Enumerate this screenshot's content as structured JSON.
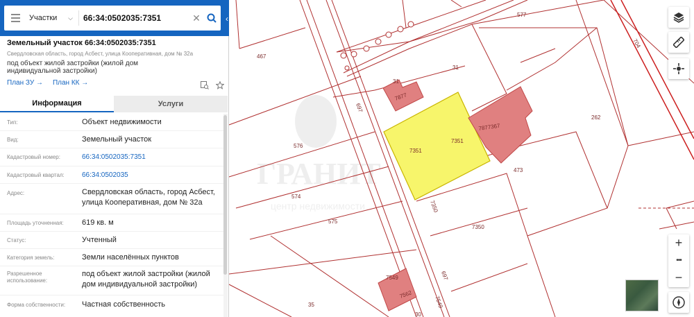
{
  "search": {
    "layer": "Участки",
    "query": "66:34:0502035:7351"
  },
  "object": {
    "title": "Земельный участок 66:34:0502035:7351",
    "address_short": "Свердловская область, город Асбест, улица Кооперативная, дом № 32а",
    "usage": "под объект жилой застройки (жилой дом индивидуальной застройки)",
    "links": [
      "План ЗУ →",
      "План КК →"
    ]
  },
  "tabs": [
    {
      "label": "Информация",
      "active": true
    },
    {
      "label": "Услуги",
      "active": false
    }
  ],
  "properties": [
    {
      "key": "Тип:",
      "value": "Объект недвижимости",
      "link": false
    },
    {
      "key": "Вид:",
      "value": "Земельный участок",
      "link": false
    },
    {
      "key": "Кадастровый номер:",
      "value": "66:34:0502035:7351",
      "link": true
    },
    {
      "key": "Кадастровый квартал:",
      "value": "66:34:0502035",
      "link": true
    },
    {
      "key": "Адрес:",
      "value": "Свердловская область, город Асбест, улица Кооперативная, дом № 32а",
      "link": false
    },
    {
      "key": "Площадь уточненная:",
      "value": "619 кв. м",
      "link": false
    },
    {
      "key": "Статус:",
      "value": "Учтенный",
      "link": false
    },
    {
      "key": "Категория земель:",
      "value": "Земли населённых пунктов",
      "link": false
    },
    {
      "key": "Разрешенное использование:",
      "value": "под объект жилой застройки (жилой дом индивидуальной застройки)",
      "link": false
    },
    {
      "key": "Форма собственности:",
      "value": "Частная собственность",
      "link": false
    }
  ],
  "map": {
    "watermark_lines": [
      "ГРАНИТ",
      "центр недвижимости"
    ],
    "labels": {
      "p467": "467",
      "p577": "577",
      "p31a": "31",
      "p31b": "31",
      "p7877": "7877",
      "p576": "576",
      "p7351a": "7351",
      "p7351b": "7351",
      "p7877_7367": "7877367",
      "p262": "262",
      "p473": "473",
      "p574": "574",
      "p575": "575",
      "p7350a": "7350",
      "p7350b": "7350",
      "p697a": "697",
      "p697b": "697",
      "p7549": "7549",
      "p7562": "7562",
      "p35": "35",
      "p7549b": "7549",
      "p30": "30",
      "p704": "704"
    },
    "colors": {
      "boundary": "#b03030",
      "selected_fill": "#f7f56b",
      "selected_stroke": "#c9b500",
      "building_fill": "#e08080",
      "building_stroke": "#c04848",
      "road_red": "#cc1f1f"
    }
  },
  "controls": {
    "layers_icon": "layers-icon",
    "ruler_icon": "ruler-icon",
    "locate_icon": "crosshair-icon",
    "zoom_in": "+",
    "zoom_more": "•••",
    "zoom_out": "−",
    "compass_icon": "compass-icon"
  }
}
